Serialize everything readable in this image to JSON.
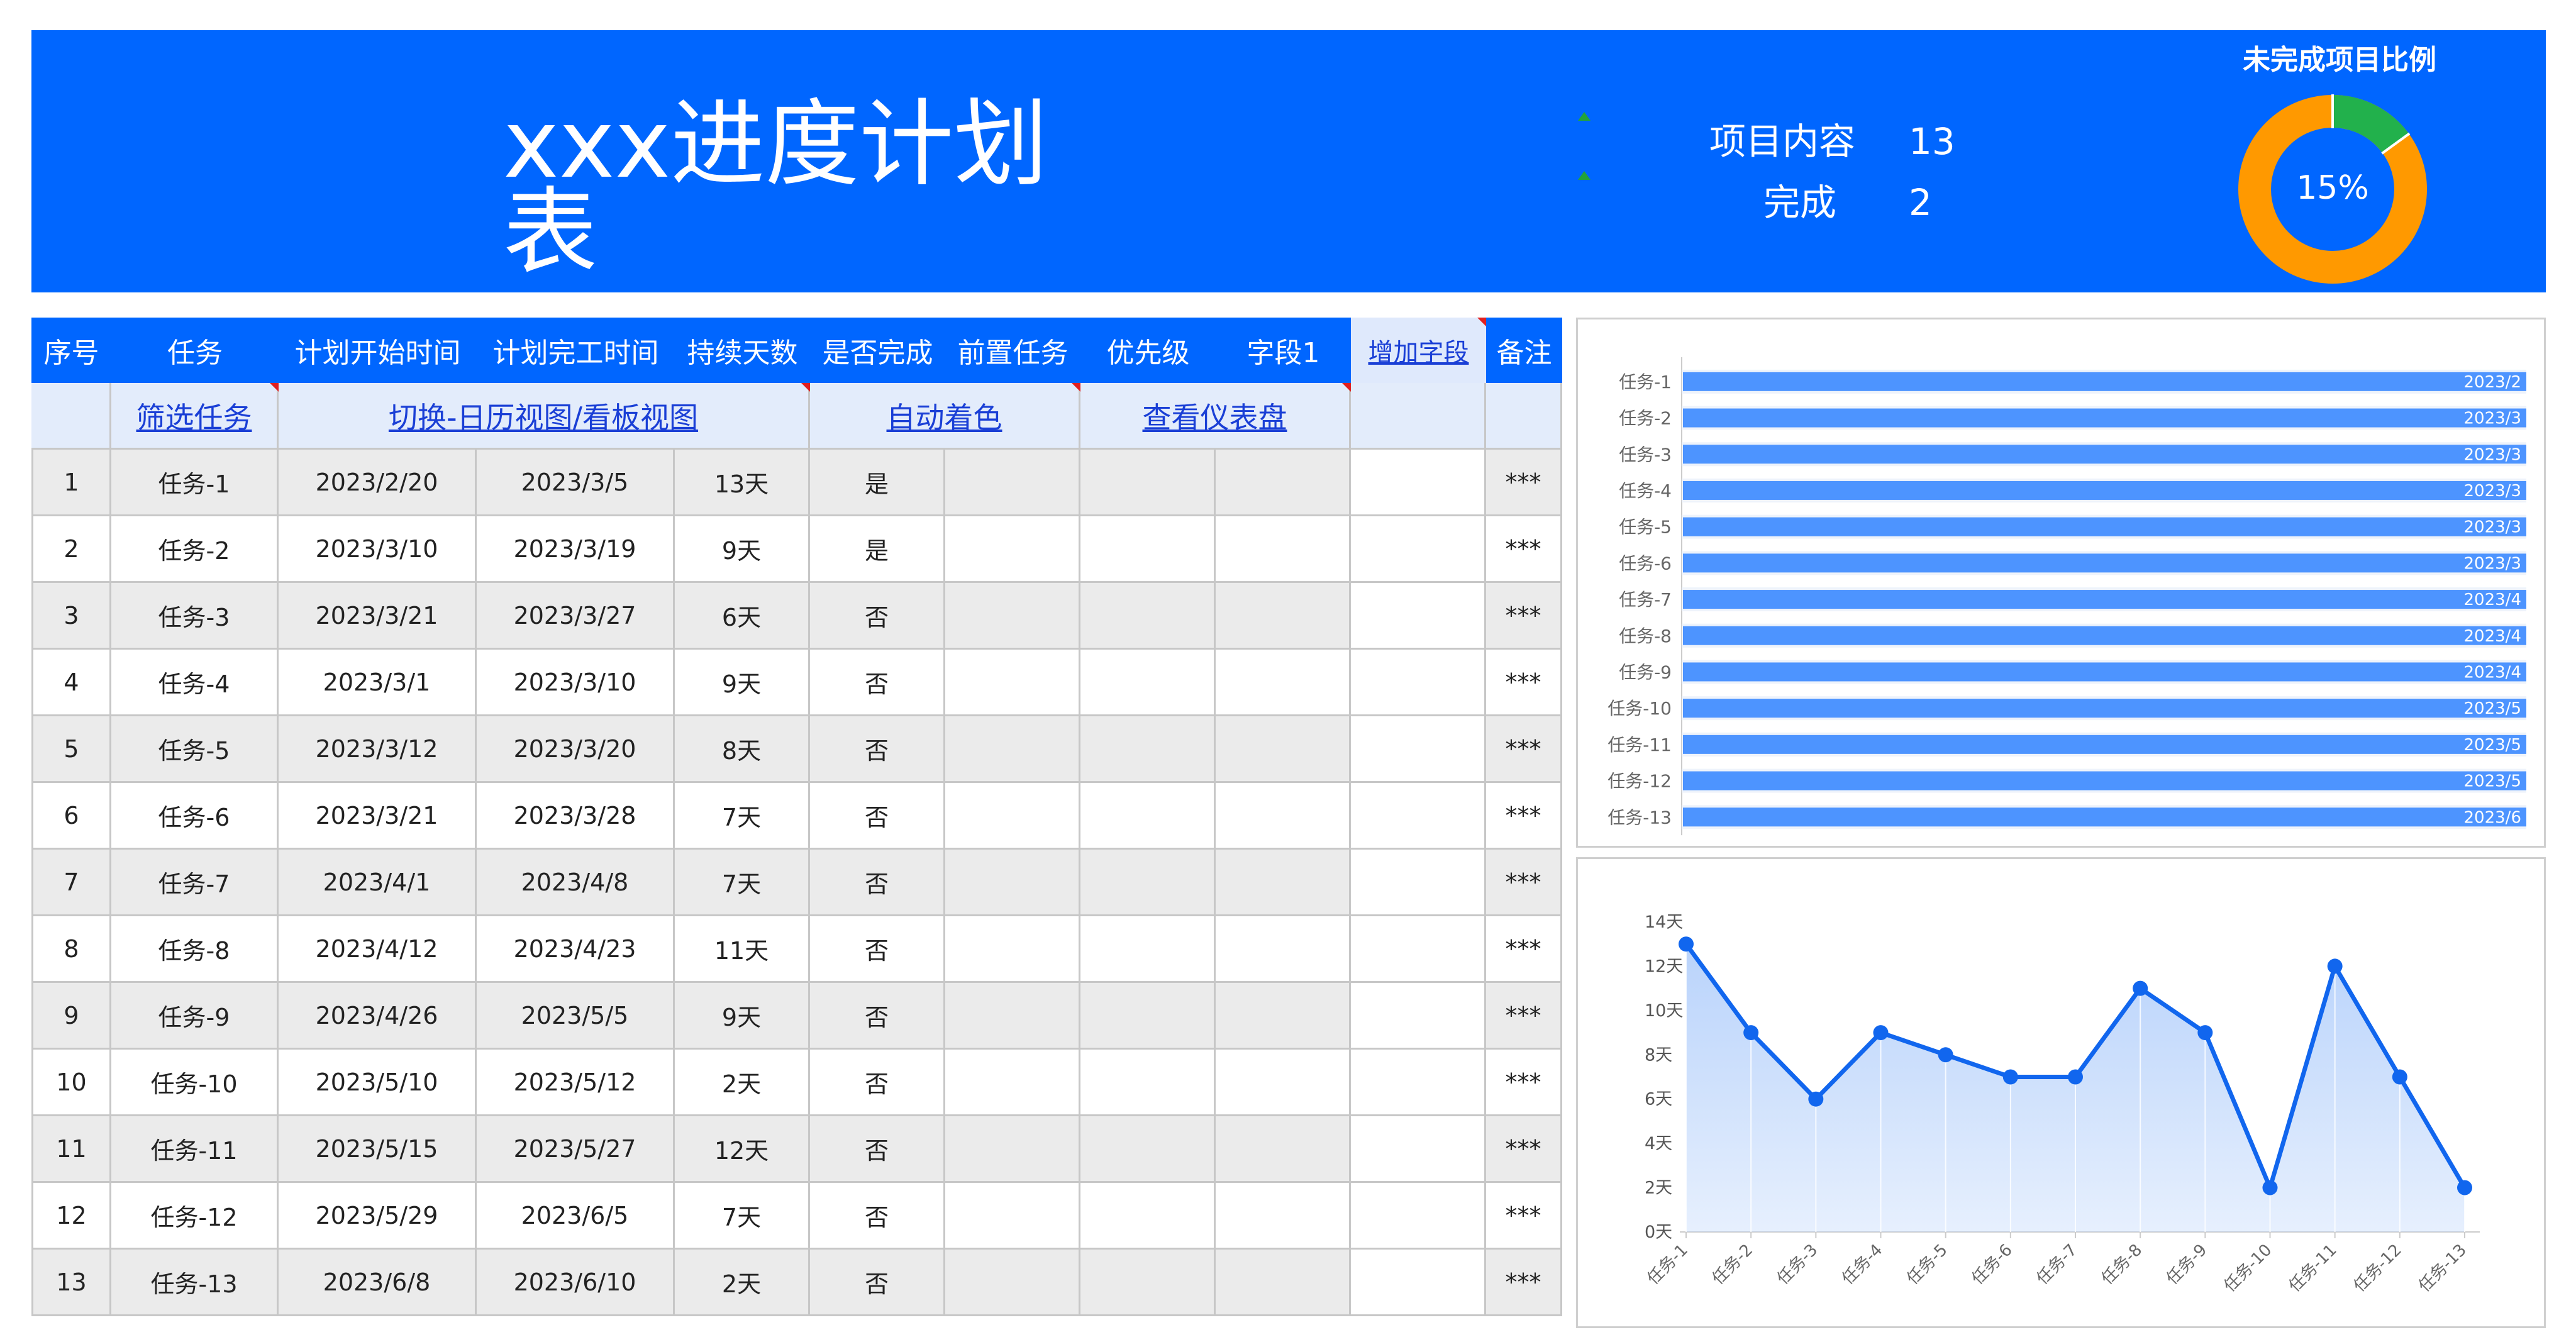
{
  "header": {
    "title": "xxx进度计划表",
    "stats": [
      {
        "label": "项目内容",
        "value": "13"
      },
      {
        "label": "完成",
        "value": "2"
      }
    ],
    "donut": {
      "title": "未完成项目比例",
      "percent_label": "15%",
      "completed_fraction": 0.15,
      "completed_color": "#22b14c",
      "remaining_color": "#ff9900"
    }
  },
  "table": {
    "columns": [
      "序号",
      "任务",
      "计划开始时间",
      "计划完工时间",
      "持续天数",
      "是否完成",
      "前置任务",
      "优先级",
      "字段1",
      "增加字段",
      "备注"
    ],
    "actions": [
      "筛选任务",
      "切换-日历视图/看板视图",
      "自动着色",
      "查看仪表盘"
    ],
    "rows": [
      {
        "no": "1",
        "task": "任务-1",
        "start": "2023/2/20",
        "end": "2023/3/5",
        "days": "13天",
        "done": "是",
        "note": "***"
      },
      {
        "no": "2",
        "task": "任务-2",
        "start": "2023/3/10",
        "end": "2023/3/19",
        "days": "9天",
        "done": "是",
        "note": "***"
      },
      {
        "no": "3",
        "task": "任务-3",
        "start": "2023/3/21",
        "end": "2023/3/27",
        "days": "6天",
        "done": "否",
        "note": "***"
      },
      {
        "no": "4",
        "task": "任务-4",
        "start": "2023/3/1",
        "end": "2023/3/10",
        "days": "9天",
        "done": "否",
        "note": "***"
      },
      {
        "no": "5",
        "task": "任务-5",
        "start": "2023/3/12",
        "end": "2023/3/20",
        "days": "8天",
        "done": "否",
        "note": "***"
      },
      {
        "no": "6",
        "task": "任务-6",
        "start": "2023/3/21",
        "end": "2023/3/28",
        "days": "7天",
        "done": "否",
        "note": "***"
      },
      {
        "no": "7",
        "task": "任务-7",
        "start": "2023/4/1",
        "end": "2023/4/8",
        "days": "7天",
        "done": "否",
        "note": "***"
      },
      {
        "no": "8",
        "task": "任务-8",
        "start": "2023/4/12",
        "end": "2023/4/23",
        "days": "11天",
        "done": "否",
        "note": "***"
      },
      {
        "no": "9",
        "task": "任务-9",
        "start": "2023/4/26",
        "end": "2023/5/5",
        "days": "9天",
        "done": "否",
        "note": "***"
      },
      {
        "no": "10",
        "task": "任务-10",
        "start": "2023/5/10",
        "end": "2023/5/12",
        "days": "2天",
        "done": "否",
        "note": "***"
      },
      {
        "no": "11",
        "task": "任务-11",
        "start": "2023/5/15",
        "end": "2023/5/27",
        "days": "12天",
        "done": "否",
        "note": "***"
      },
      {
        "no": "12",
        "task": "任务-12",
        "start": "2023/5/29",
        "end": "2023/6/5",
        "days": "7天",
        "done": "否",
        "note": "***"
      },
      {
        "no": "13",
        "task": "任务-13",
        "start": "2023/6/8",
        "end": "2023/6/10",
        "days": "2天",
        "done": "否",
        "note": "***"
      }
    ]
  },
  "chart_data": [
    {
      "type": "bar",
      "orientation": "horizontal",
      "categories": [
        "任务-1",
        "任务-2",
        "任务-3",
        "任务-4",
        "任务-5",
        "任务-6",
        "任务-7",
        "任务-8",
        "任务-9",
        "任务-10",
        "任务-11",
        "任务-12",
        "任务-13"
      ],
      "bar_labels": [
        "2023/2",
        "2023/3",
        "2023/3",
        "2023/3",
        "2023/3",
        "2023/3",
        "2023/4",
        "2023/4",
        "2023/4",
        "2023/5",
        "2023/5",
        "2023/5",
        "2023/6"
      ],
      "color": "#4d94ff"
    },
    {
      "type": "area",
      "categories": [
        "任务-1",
        "任务-2",
        "任务-3",
        "任务-4",
        "任务-5",
        "任务-6",
        "任务-7",
        "任务-8",
        "任务-9",
        "任务-10",
        "任务-11",
        "任务-12",
        "任务-13"
      ],
      "values": [
        13,
        9,
        6,
        9,
        8,
        7,
        7,
        11,
        9,
        2,
        12,
        7,
        2
      ],
      "y_ticks": [
        "0天",
        "2天",
        "4天",
        "6天",
        "8天",
        "10天",
        "12天",
        "14天"
      ],
      "ylim": [
        0,
        14
      ],
      "line_color": "#1166ee",
      "fill_color": "#b9d3fb"
    }
  ]
}
